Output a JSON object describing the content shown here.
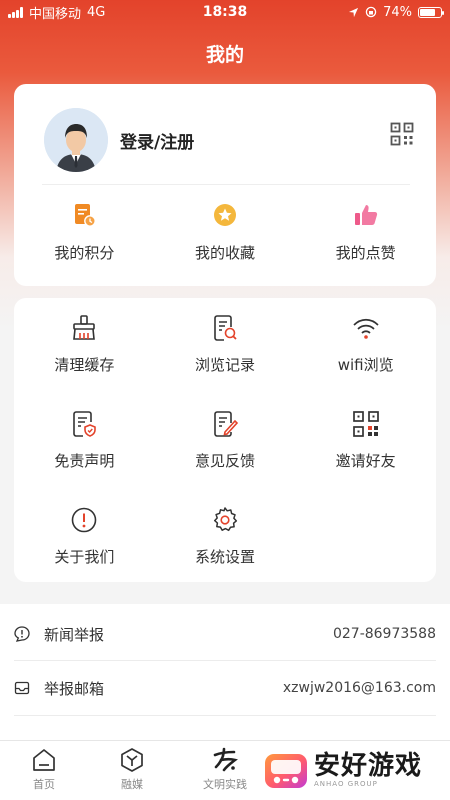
{
  "status_bar": {
    "carrier": "中国移动",
    "network": "4G",
    "time": "18:38",
    "battery": "74%"
  },
  "header": {
    "title": "我的"
  },
  "profile": {
    "login_label": "登录/注册",
    "quick_links": [
      {
        "label": "我的积分",
        "icon": "points-icon"
      },
      {
        "label": "我的收藏",
        "icon": "star-icon"
      },
      {
        "label": "我的点赞",
        "icon": "thumbs-up-icon"
      }
    ]
  },
  "menu": {
    "items": [
      {
        "label": "清理缓存",
        "icon": "broom-icon"
      },
      {
        "label": "浏览记录",
        "icon": "history-icon"
      },
      {
        "label": "wifi浏览",
        "icon": "wifi-icon"
      },
      {
        "label": "免责声明",
        "icon": "shield-document-icon"
      },
      {
        "label": "意见反馈",
        "icon": "edit-icon"
      },
      {
        "label": "邀请好友",
        "icon": "qr-code-icon"
      },
      {
        "label": "关于我们",
        "icon": "info-icon"
      },
      {
        "label": "系统设置",
        "icon": "gear-icon"
      }
    ]
  },
  "info": {
    "rows": [
      {
        "label": "新闻举报",
        "value": "027-86973588",
        "icon": "report-icon"
      },
      {
        "label": "举报邮箱",
        "value": "xzwjw2016@163.com",
        "icon": "mail-icon"
      }
    ]
  },
  "tab_bar": {
    "tabs": [
      {
        "label": "首页",
        "icon": "home-icon"
      },
      {
        "label": "融媒",
        "icon": "media-icon"
      },
      {
        "label": "文明实践",
        "icon": "practice-icon"
      }
    ]
  },
  "watermark": {
    "main": "安好游戏",
    "sub": "ANHAO GROUP"
  },
  "colors": {
    "brand_red": "#e3432b",
    "accent_orange": "#f08a24",
    "accent_pink": "#ee5a8a"
  }
}
